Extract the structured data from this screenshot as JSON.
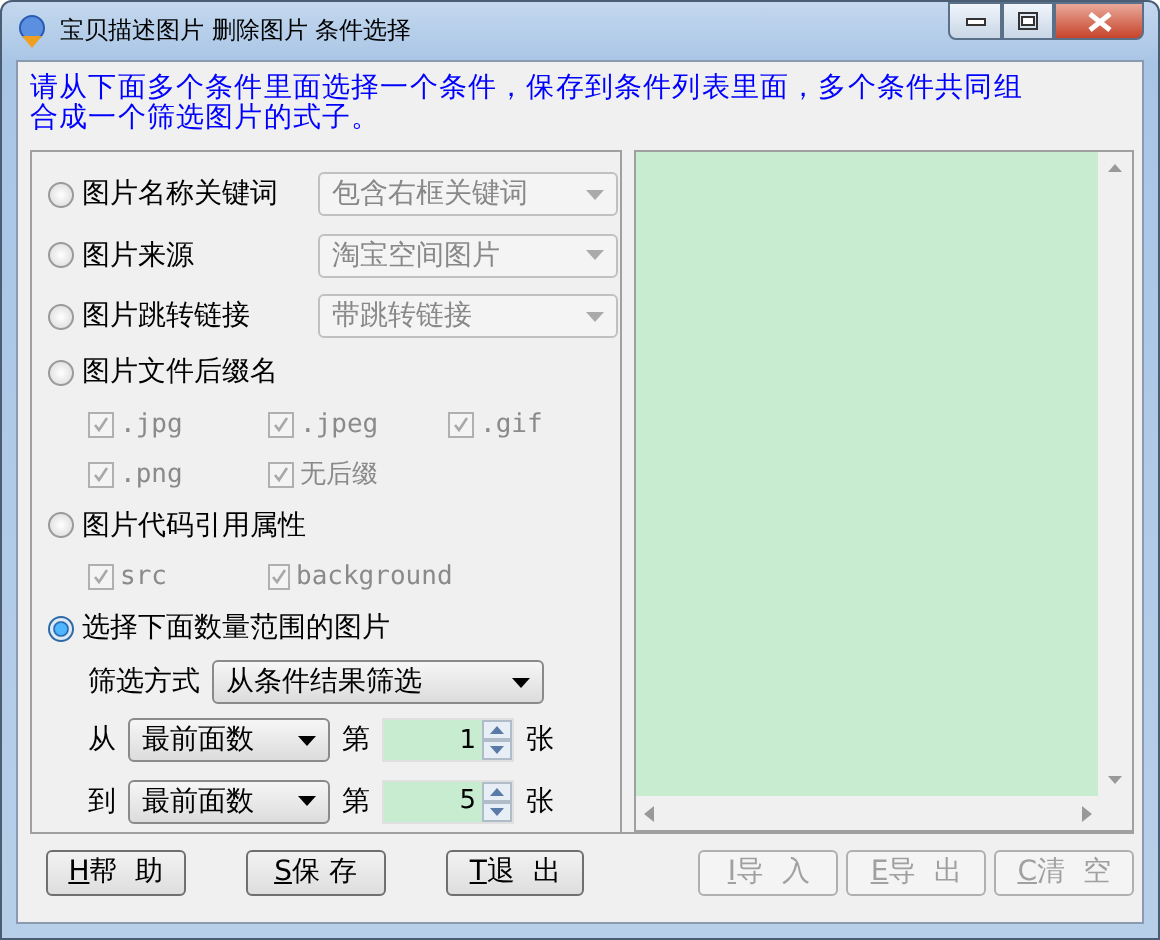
{
  "window": {
    "title": "宝贝描述图片 删除图片 条件选择"
  },
  "instruction": "请从下面多个条件里面选择一个条件，保存到条件列表里面，多个条件共同组合成一个筛选图片的式子。",
  "conditions": [
    {
      "kind": "dropdown",
      "label": "图片名称关键词",
      "selected": false,
      "value": "包含右框关键词"
    },
    {
      "kind": "dropdown",
      "label": "图片来源",
      "selected": false,
      "value": "淘宝空间图片"
    },
    {
      "kind": "dropdown",
      "label": "图片跳转链接",
      "selected": false,
      "value": "带跳转链接"
    },
    {
      "kind": "checks",
      "label": "图片文件后缀名",
      "selected": false,
      "options": [
        {
          "label": ".jpg",
          "checked": true
        },
        {
          "label": ".jpeg",
          "checked": true
        },
        {
          "label": ".gif",
          "checked": true
        },
        {
          "label": ".png",
          "checked": true
        },
        {
          "label": "无后缀",
          "checked": true
        }
      ]
    },
    {
      "kind": "checks",
      "label": "图片代码引用属性",
      "selected": false,
      "options": [
        {
          "label": "src",
          "checked": true
        },
        {
          "label": "background",
          "checked": true
        }
      ]
    },
    {
      "kind": "range",
      "label": "选择下面数量范围的图片",
      "selected": true,
      "mode_label": "筛选方式",
      "mode_value": "从条件结果筛选",
      "rows": [
        {
          "label": "从",
          "value": "最前面数",
          "ordinal": "第",
          "count": "1",
          "unit": "张"
        },
        {
          "label": "到",
          "value": "最前面数",
          "ordinal": "第",
          "count": "5",
          "unit": "张"
        }
      ]
    }
  ],
  "buttons": [
    {
      "hotkey": "H",
      "label": "帮  助",
      "disabled": false
    },
    {
      "hotkey": "S",
      "label": "保 存",
      "disabled": false
    },
    {
      "hotkey": "T",
      "label": "退  出",
      "disabled": false
    },
    {
      "hotkey": "I",
      "label": "导  入",
      "disabled": true
    },
    {
      "hotkey": "E",
      "label": "导  出",
      "disabled": true
    },
    {
      "hotkey": "C",
      "label": "清  空",
      "disabled": true
    }
  ]
}
